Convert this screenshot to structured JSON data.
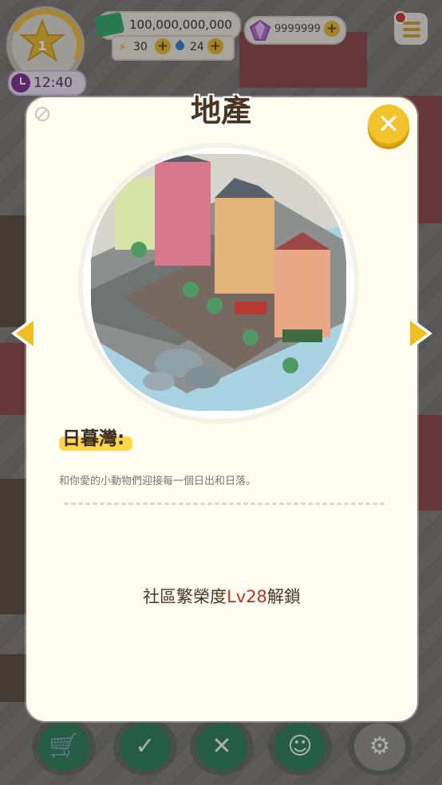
{
  "hud": {
    "level": "1",
    "time": "12:40",
    "money": "100,000,000,000",
    "energy": "30",
    "water": "24",
    "gems": "9999999"
  },
  "toolbar": {
    "items": [
      {
        "icon": "cart-icon"
      },
      {
        "icon": "checklist-icon"
      },
      {
        "icon": "tools-icon"
      },
      {
        "icon": "face-icon"
      },
      {
        "icon": "wrench-icon"
      }
    ]
  },
  "modal": {
    "title": "地產",
    "location_name": "日暮灣:",
    "description": "和你愛的小動物們迎接每一個日出和日落。",
    "unlock_prefix": "社區繁榮度",
    "unlock_level": "Lv28",
    "unlock_suffix": "解鎖"
  },
  "colors": {
    "panel": "#fdfdf0",
    "title": "#4a3520",
    "highlight": "#ffd54a",
    "level_red": "#c0332b",
    "close": "#f3c32b"
  }
}
